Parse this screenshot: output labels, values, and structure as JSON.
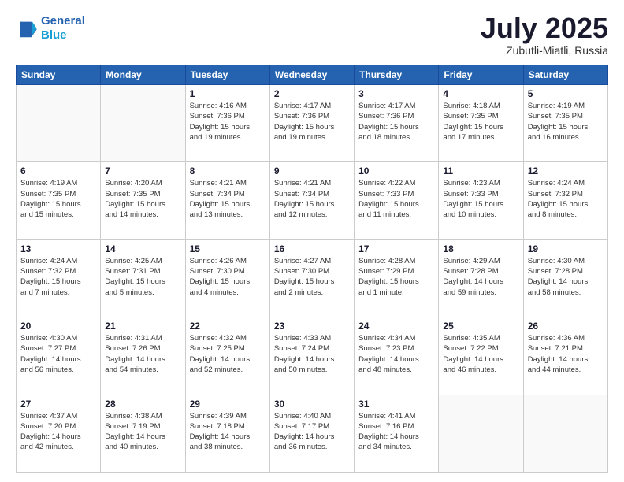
{
  "header": {
    "logo_line1": "General",
    "logo_line2": "Blue",
    "month": "July 2025",
    "location": "Zubutli-Miatli, Russia"
  },
  "weekdays": [
    "Sunday",
    "Monday",
    "Tuesday",
    "Wednesday",
    "Thursday",
    "Friday",
    "Saturday"
  ],
  "weeks": [
    [
      {
        "day": "",
        "info": ""
      },
      {
        "day": "",
        "info": ""
      },
      {
        "day": "1",
        "info": "Sunrise: 4:16 AM\nSunset: 7:36 PM\nDaylight: 15 hours\nand 19 minutes."
      },
      {
        "day": "2",
        "info": "Sunrise: 4:17 AM\nSunset: 7:36 PM\nDaylight: 15 hours\nand 19 minutes."
      },
      {
        "day": "3",
        "info": "Sunrise: 4:17 AM\nSunset: 7:36 PM\nDaylight: 15 hours\nand 18 minutes."
      },
      {
        "day": "4",
        "info": "Sunrise: 4:18 AM\nSunset: 7:35 PM\nDaylight: 15 hours\nand 17 minutes."
      },
      {
        "day": "5",
        "info": "Sunrise: 4:19 AM\nSunset: 7:35 PM\nDaylight: 15 hours\nand 16 minutes."
      }
    ],
    [
      {
        "day": "6",
        "info": "Sunrise: 4:19 AM\nSunset: 7:35 PM\nDaylight: 15 hours\nand 15 minutes."
      },
      {
        "day": "7",
        "info": "Sunrise: 4:20 AM\nSunset: 7:35 PM\nDaylight: 15 hours\nand 14 minutes."
      },
      {
        "day": "8",
        "info": "Sunrise: 4:21 AM\nSunset: 7:34 PM\nDaylight: 15 hours\nand 13 minutes."
      },
      {
        "day": "9",
        "info": "Sunrise: 4:21 AM\nSunset: 7:34 PM\nDaylight: 15 hours\nand 12 minutes."
      },
      {
        "day": "10",
        "info": "Sunrise: 4:22 AM\nSunset: 7:33 PM\nDaylight: 15 hours\nand 11 minutes."
      },
      {
        "day": "11",
        "info": "Sunrise: 4:23 AM\nSunset: 7:33 PM\nDaylight: 15 hours\nand 10 minutes."
      },
      {
        "day": "12",
        "info": "Sunrise: 4:24 AM\nSunset: 7:32 PM\nDaylight: 15 hours\nand 8 minutes."
      }
    ],
    [
      {
        "day": "13",
        "info": "Sunrise: 4:24 AM\nSunset: 7:32 PM\nDaylight: 15 hours\nand 7 minutes."
      },
      {
        "day": "14",
        "info": "Sunrise: 4:25 AM\nSunset: 7:31 PM\nDaylight: 15 hours\nand 5 minutes."
      },
      {
        "day": "15",
        "info": "Sunrise: 4:26 AM\nSunset: 7:30 PM\nDaylight: 15 hours\nand 4 minutes."
      },
      {
        "day": "16",
        "info": "Sunrise: 4:27 AM\nSunset: 7:30 PM\nDaylight: 15 hours\nand 2 minutes."
      },
      {
        "day": "17",
        "info": "Sunrise: 4:28 AM\nSunset: 7:29 PM\nDaylight: 15 hours\nand 1 minute."
      },
      {
        "day": "18",
        "info": "Sunrise: 4:29 AM\nSunset: 7:28 PM\nDaylight: 14 hours\nand 59 minutes."
      },
      {
        "day": "19",
        "info": "Sunrise: 4:30 AM\nSunset: 7:28 PM\nDaylight: 14 hours\nand 58 minutes."
      }
    ],
    [
      {
        "day": "20",
        "info": "Sunrise: 4:30 AM\nSunset: 7:27 PM\nDaylight: 14 hours\nand 56 minutes."
      },
      {
        "day": "21",
        "info": "Sunrise: 4:31 AM\nSunset: 7:26 PM\nDaylight: 14 hours\nand 54 minutes."
      },
      {
        "day": "22",
        "info": "Sunrise: 4:32 AM\nSunset: 7:25 PM\nDaylight: 14 hours\nand 52 minutes."
      },
      {
        "day": "23",
        "info": "Sunrise: 4:33 AM\nSunset: 7:24 PM\nDaylight: 14 hours\nand 50 minutes."
      },
      {
        "day": "24",
        "info": "Sunrise: 4:34 AM\nSunset: 7:23 PM\nDaylight: 14 hours\nand 48 minutes."
      },
      {
        "day": "25",
        "info": "Sunrise: 4:35 AM\nSunset: 7:22 PM\nDaylight: 14 hours\nand 46 minutes."
      },
      {
        "day": "26",
        "info": "Sunrise: 4:36 AM\nSunset: 7:21 PM\nDaylight: 14 hours\nand 44 minutes."
      }
    ],
    [
      {
        "day": "27",
        "info": "Sunrise: 4:37 AM\nSunset: 7:20 PM\nDaylight: 14 hours\nand 42 minutes."
      },
      {
        "day": "28",
        "info": "Sunrise: 4:38 AM\nSunset: 7:19 PM\nDaylight: 14 hours\nand 40 minutes."
      },
      {
        "day": "29",
        "info": "Sunrise: 4:39 AM\nSunset: 7:18 PM\nDaylight: 14 hours\nand 38 minutes."
      },
      {
        "day": "30",
        "info": "Sunrise: 4:40 AM\nSunset: 7:17 PM\nDaylight: 14 hours\nand 36 minutes."
      },
      {
        "day": "31",
        "info": "Sunrise: 4:41 AM\nSunset: 7:16 PM\nDaylight: 14 hours\nand 34 minutes."
      },
      {
        "day": "",
        "info": ""
      },
      {
        "day": "",
        "info": ""
      }
    ]
  ]
}
